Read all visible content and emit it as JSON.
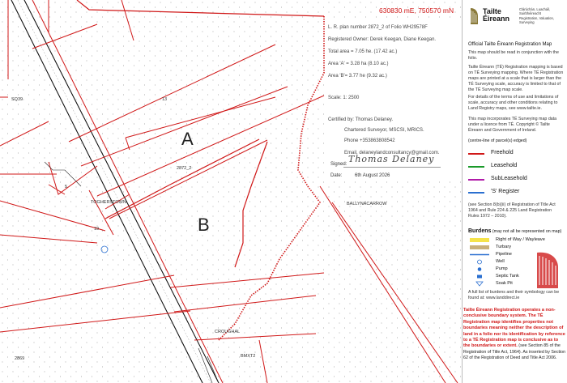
{
  "coordinates": "630830 mE, 750570 mN",
  "info": {
    "plan_number": "L. R. plan number 2872_2 of Folio WH29578F",
    "owner": "Registered Owner: Derek Keegan, Diane Keegan.",
    "total_area": "Total area = 7.05 he. (17.42 ac.)",
    "area_a": "Area 'A' = 3.28 ha (8.10 ac.)",
    "area_b": "Area 'B'= 3.77 he (9.32 ac.)",
    "scale": "Scale: 1: 2500",
    "certified": "Certified by: Thomas Delaney.",
    "surveyor": "Chartered Surveyor, MSCSI, MRICS.",
    "phone": "Phone +353863808542",
    "email": "Email, delaneylandconsultancy@gmail.com.",
    "signed_label": "Signed:",
    "signature": "Thomas Delaney",
    "date_label": "Date:",
    "date": "6th August 2026"
  },
  "map": {
    "label_a": "A",
    "label_b": "B",
    "labels": [
      {
        "id": "sq39",
        "text": "SQ39"
      },
      {
        "id": "p13",
        "text": "13"
      },
      {
        "id": "p2872",
        "text": "2872_2"
      },
      {
        "id": "p5",
        "text": "5"
      },
      {
        "id": "toghers",
        "text": "TOGHERSTOWN"
      },
      {
        "id": "p19",
        "text": "19"
      },
      {
        "id": "bally",
        "text": "BALLYNACARROW"
      },
      {
        "id": "crough",
        "text": "CROUGHAL"
      },
      {
        "id": "bmxt",
        "text": "BMXT2"
      },
      {
        "id": "p2869",
        "text": "2869"
      }
    ]
  },
  "panel": {
    "brand": "Tailte Éireann",
    "brand_sub": "Clárúchán, Luacháil, Suirbhéireacht\nRegistration, Valuation, Surveying",
    "title": "Official Tailte Éireann Registration Map",
    "intro": "This map should be read in conjunction with the folio.",
    "text1": "Tailte Éireann (TÉ) Registration mapping is based on TÉ Surveying mapping. Where TÉ Registration maps are printed at a scale that is larger than the TÉ Surveying scale, accuracy is limited to that of the TÉ Surveying map scale.",
    "text2": "For details of the terms of use and limitations of scale, accuracy and other conditions relating to Land Registry maps, see www.tailte.ie.",
    "text3": "This map incorporates TÉ Surveying map data under a licence from TÉ. Copyright © Tailte Éireann and Government of Ireland.",
    "legend_head": "(centre-line of parcel(s) edged)",
    "legend": [
      {
        "label": "Freehold",
        "color": "#d01818"
      },
      {
        "label": "Leasehold",
        "color": "#1a9a2a"
      },
      {
        "label": "SubLeasehold",
        "color": "#b01aa8"
      },
      {
        "label": "'S' Register",
        "color": "#2a6fd0"
      }
    ],
    "legend_note": "(see Section 8(b)(ii) of Registration of Title Act 1964 and Rule 224 & 225 Land Registration Rules 1972 – 2010).",
    "burdens_title": "Burdens",
    "burdens_sub": "(may not all be represented on map)",
    "burdens": [
      {
        "label": "Right of Way / Wayleave"
      },
      {
        "label": "Turbary"
      },
      {
        "label": "Pipeline"
      },
      {
        "label": "Well"
      },
      {
        "label": "Pump"
      },
      {
        "label": "Septic Tank"
      },
      {
        "label": "Soak Pit"
      }
    ],
    "burden_note": "A full list of burdens and their symbology can be found at: www.landdirect.ie",
    "warning_bold": "Tailte Éireann Registration operates a non-conclusive boundary system. The TÉ Registration map identifies properties not boundaries meaning neither the description of land in a folio nor its identification by reference to a TÉ Registration map is conclusive as to the boundaries or extent.",
    "warning_rest": " (see Section 85 of the Registration of Title Act, 1964). As inserted by Section 62 of the Registration of Deed and Title Act 2006."
  }
}
